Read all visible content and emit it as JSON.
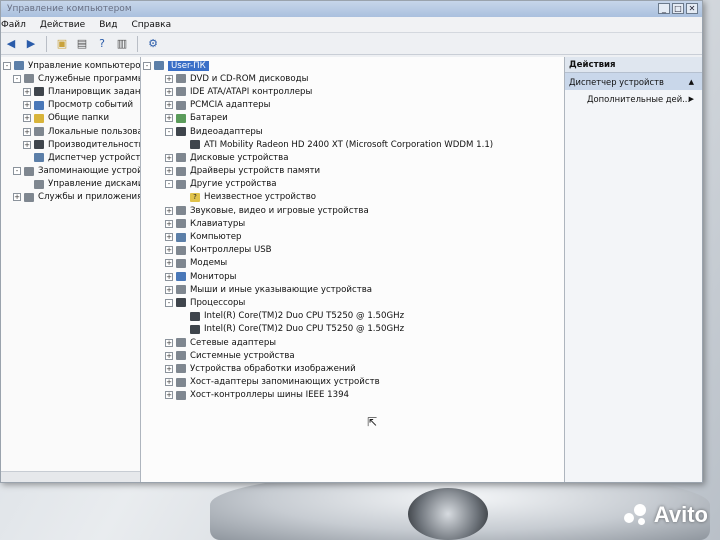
{
  "window": {
    "title": "Управление компьютером",
    "minimize": "_",
    "maximize": "□",
    "close": "✕"
  },
  "menu": [
    "Файл",
    "Действие",
    "Вид",
    "Справка"
  ],
  "toolbar_icons": [
    "back-arrow-icon",
    "forward-arrow-icon",
    "up-folder-icon",
    "properties-icon",
    "help-icon",
    "show-hide-icon",
    "scan-hardware-icon"
  ],
  "left_tree": [
    {
      "label": "Управление компьютером (л",
      "level": 0,
      "expander": "-",
      "icon": "pc"
    },
    {
      "label": "Служебные программы",
      "level": 1,
      "expander": "-",
      "icon": "gray"
    },
    {
      "label": "Планировщик задани",
      "level": 2,
      "expander": "+",
      "icon": "dark"
    },
    {
      "label": "Просмотр событий",
      "level": 2,
      "expander": "+",
      "icon": "blue"
    },
    {
      "label": "Общие папки",
      "level": 2,
      "expander": "+",
      "icon": "yellow"
    },
    {
      "label": "Локальные пользова",
      "level": 2,
      "expander": "+",
      "icon": "gray"
    },
    {
      "label": "Производительность",
      "level": 2,
      "expander": "+",
      "icon": "dark"
    },
    {
      "label": "Диспетчер устройств",
      "level": 2,
      "expander": "",
      "icon": "pc"
    },
    {
      "label": "Запоминающие устройст",
      "level": 1,
      "expander": "-",
      "icon": "gray"
    },
    {
      "label": "Управление дисками",
      "level": 2,
      "expander": "",
      "icon": "gray"
    },
    {
      "label": "Службы и приложения",
      "level": 1,
      "expander": "+",
      "icon": "gray"
    }
  ],
  "device_tree": {
    "root": "User-ПК",
    "items": [
      {
        "label": "DVD и CD-ROM дисководы",
        "level": 1,
        "expander": "+",
        "icon": "gray"
      },
      {
        "label": "IDE ATA/ATAPI контроллеры",
        "level": 1,
        "expander": "+",
        "icon": "gray"
      },
      {
        "label": "PCMCIA адаптеры",
        "level": 1,
        "expander": "+",
        "icon": "gray"
      },
      {
        "label": "Батареи",
        "level": 1,
        "expander": "+",
        "icon": "green"
      },
      {
        "label": "Видеоадаптеры",
        "level": 1,
        "expander": "-",
        "icon": "dark"
      },
      {
        "label": "ATI Mobility Radeon HD 2400 XT (Microsoft Corporation WDDM 1.1)",
        "level": 2,
        "expander": "",
        "icon": "dark"
      },
      {
        "label": "Дисковые устройства",
        "level": 1,
        "expander": "+",
        "icon": "gray"
      },
      {
        "label": "Драйверы устройств памяти",
        "level": 1,
        "expander": "+",
        "icon": "gray"
      },
      {
        "label": "Другие устройства",
        "level": 1,
        "expander": "-",
        "icon": "gray"
      },
      {
        "label": "Неизвестное устройство",
        "level": 2,
        "expander": "",
        "icon": "warn"
      },
      {
        "label": "Звуковые, видео и игровые устройства",
        "level": 1,
        "expander": "+",
        "icon": "gray"
      },
      {
        "label": "Клавиатуры",
        "level": 1,
        "expander": "+",
        "icon": "gray"
      },
      {
        "label": "Компьютер",
        "level": 1,
        "expander": "+",
        "icon": "pc"
      },
      {
        "label": "Контроллеры USB",
        "level": 1,
        "expander": "+",
        "icon": "gray"
      },
      {
        "label": "Модемы",
        "level": 1,
        "expander": "+",
        "icon": "gray"
      },
      {
        "label": "Мониторы",
        "level": 1,
        "expander": "+",
        "icon": "blue"
      },
      {
        "label": "Мыши и иные указывающие устройства",
        "level": 1,
        "expander": "+",
        "icon": "gray"
      },
      {
        "label": "Процессоры",
        "level": 1,
        "expander": "-",
        "icon": "dark"
      },
      {
        "label": "Intel(R) Core(TM)2 Duo CPU     T5250  @ 1.50GHz",
        "level": 2,
        "expander": "",
        "icon": "dark"
      },
      {
        "label": "Intel(R) Core(TM)2 Duo CPU     T5250  @ 1.50GHz",
        "level": 2,
        "expander": "",
        "icon": "dark"
      },
      {
        "label": "Сетевые адаптеры",
        "level": 1,
        "expander": "+",
        "icon": "gray"
      },
      {
        "label": "Системные устройства",
        "level": 1,
        "expander": "+",
        "icon": "gray"
      },
      {
        "label": "Устройства обработки изображений",
        "level": 1,
        "expander": "+",
        "icon": "gray"
      },
      {
        "label": "Хост-адаптеры запоминающих устройств",
        "level": 1,
        "expander": "+",
        "icon": "gray"
      },
      {
        "label": "Хост-контроллеры шины IEEE 1394",
        "level": 1,
        "expander": "+",
        "icon": "gray"
      }
    ]
  },
  "actions": {
    "header": "Действия",
    "section": "Диспетчер устройств",
    "item": "Дополнительные дей..."
  },
  "watermark": "Avito"
}
